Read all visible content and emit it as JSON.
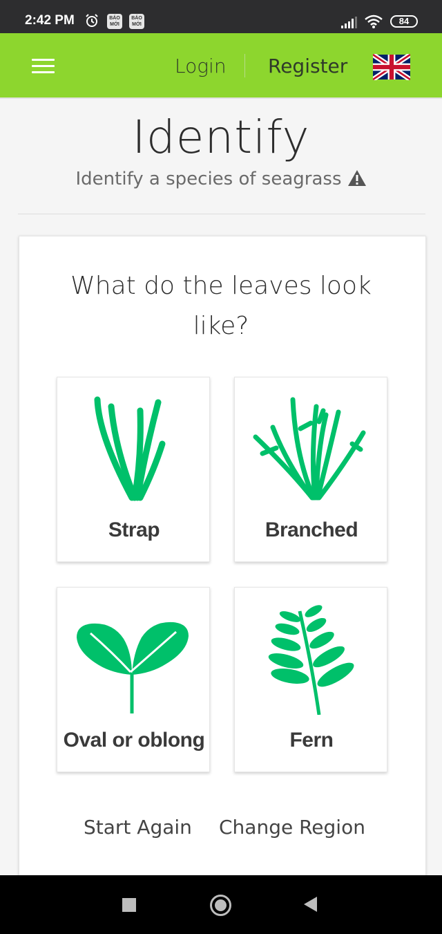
{
  "status_bar": {
    "time": "2:42 PM",
    "news_badge_1": "BÁO MỚI",
    "news_badge_2": "BÁO MỚI",
    "battery": "84"
  },
  "header": {
    "login": "Login",
    "register": "Register",
    "language_icon": "uk-flag-icon"
  },
  "page": {
    "title": "Identify",
    "subtitle": "Identify a species of seagrass"
  },
  "question": "What do the leaves look like?",
  "options": [
    {
      "label": "Strap",
      "icon": "strap-leaf-icon"
    },
    {
      "label": "Branched",
      "icon": "branched-leaf-icon"
    },
    {
      "label": "Oval or oblong",
      "icon": "oval-leaf-icon"
    },
    {
      "label": "Fern",
      "icon": "fern-leaf-icon"
    }
  ],
  "links": {
    "start_again": "Start Again",
    "change_region": "Change Region"
  },
  "colors": {
    "header_green": "#8dd62e",
    "leaf_green": "#00c06a"
  }
}
